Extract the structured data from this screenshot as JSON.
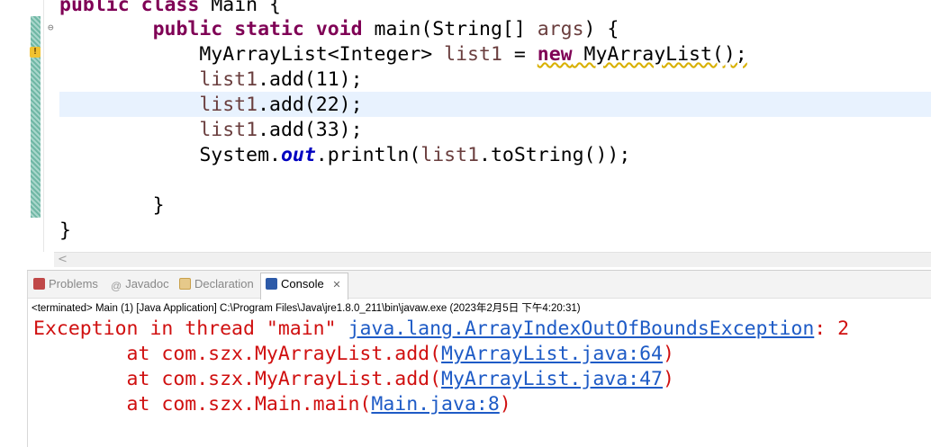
{
  "editor": {
    "lines": {
      "l0": {
        "kw1": "public",
        "kw2": "class",
        "name": "Main {"
      },
      "l1": {
        "kw1": "public",
        "kw2": "static",
        "kw3": "void",
        "rest": "main(String[] ",
        "param": "args",
        "end": ") {"
      },
      "l2": {
        "type": "MyArrayList<Integer> ",
        "var": "list1",
        "eq": " = ",
        "kw": "new",
        "ctor": " MyArrayList();"
      },
      "l3": {
        "var": "list1",
        "rest": ".add(11);"
      },
      "l4": {
        "var": "list1",
        "rest": ".add(22);"
      },
      "l5": {
        "var": "list1",
        "rest": ".add(33);"
      },
      "l6": {
        "pre": "System.",
        "field": "out",
        "mid": ".println(",
        "var": "list1",
        "end": ".toString());"
      },
      "l7": {
        "text": "}"
      },
      "l8": {
        "text": "}"
      }
    },
    "scroll_left_glyph": "<",
    "fold_glyph": "⊖",
    "warning_glyph": "!"
  },
  "panel": {
    "tabs": [
      {
        "label": "Problems",
        "icon": "problems-icon",
        "color": "#c04848"
      },
      {
        "label": "Javadoc",
        "icon": "javadoc-icon",
        "color": "#9a9a9a"
      },
      {
        "label": "Declaration",
        "icon": "declaration-icon",
        "color": "#c9a04a"
      },
      {
        "label": "Console",
        "icon": "console-icon",
        "color": "#2d5aa8"
      }
    ],
    "close_glyph": "✕",
    "status": "<terminated> Main (1) [Java Application] C:\\Program Files\\Java\\jre1.8.0_211\\bin\\javaw.exe (2023年2月5日 下午4:20:31)",
    "console": {
      "line1": {
        "prefix": "Exception in thread \"main\" ",
        "link": "java.lang.ArrayIndexOutOfBoundsException",
        "suffix": ": 2"
      },
      "line2": {
        "prefix": "        at com.szx.MyArrayList.add(",
        "link": "MyArrayList.java:64",
        "suffix": ")"
      },
      "line3": {
        "prefix": "        at com.szx.MyArrayList.add(",
        "link": "MyArrayList.java:47",
        "suffix": ")"
      },
      "line4": {
        "prefix": "        at com.szx.Main.main(",
        "link": "Main.java:8",
        "suffix": ")"
      }
    }
  }
}
